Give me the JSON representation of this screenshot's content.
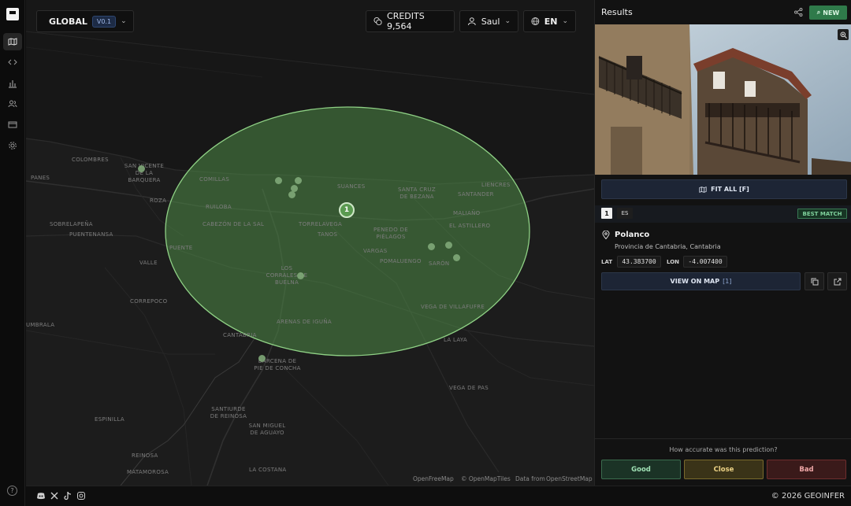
{
  "map_bar": {
    "scope_label": "GLOBAL",
    "version": "V0.1",
    "credits_label": "CREDITS 9,564",
    "user_name": "Saul",
    "language": "EN"
  },
  "map": {
    "result_pin_label": "1",
    "area_color": "#4f8a47",
    "place_labels": [
      "COLOMBRES",
      "SAN VICENTE DE LA BARQUERA",
      "PANES",
      "COMILLAS",
      "SUANCES",
      "SANTA CRUZ DE BEZANA",
      "SANTANDER",
      "LIENCRES",
      "RUILOBA",
      "ROZA",
      "SOBRELAPEÑA",
      "PUENTENANSA",
      "CABEZÓN DE LA SAL",
      "TORRELAVEGA",
      "TANOS",
      "PENEDO DE PIÉLAGOS",
      "MALIAÑO",
      "EL ASTILLERO",
      "PUENTE",
      "VALLE",
      "LOS CORRALES DE BUELNA",
      "VARGAS",
      "POMALUENGO",
      "SARÓN",
      "CORREPOCO",
      "VEGA DE VILLAFUFRE",
      "UMBRALA",
      "ARENAS DE IGUÑA",
      "CANTABRIA",
      "LA LAYA",
      "BÁRCENA DE PIE DE CONCHA",
      "VEGA DE PAS",
      "ESPINILLA",
      "SANTIURDE DE REINOSA",
      "SAN MIGUEL DE AGUAYO",
      "REINOSA",
      "MATAMOROSA",
      "LA COSTANA"
    ],
    "attribution": {
      "openfreemap": "OpenFreeMap",
      "openmaptiles": "© OpenMapTiles",
      "data_from": "Data from",
      "osm": "OpenStreetMap"
    }
  },
  "footer": {
    "copyright": "© 2026 GEOINFER"
  },
  "panel": {
    "title": "Results",
    "new_label": "NEW",
    "fit_all_label": "FIT ALL [F]",
    "result": {
      "rank": "1",
      "country_code": "ES",
      "best_match_label": "BEST MATCH",
      "place_name": "Polanco",
      "region": "Provincia de Cantabria, Cantabria",
      "lat_label": "LAT",
      "lat_value": "43.383700",
      "lon_label": "LON",
      "lon_value": "-4.007400",
      "view_on_map_label": "VIEW ON MAP",
      "view_on_map_count": "[1]"
    },
    "feedback": {
      "question": "How accurate was this prediction?",
      "good_label": "Good",
      "close_label": "Close",
      "bad_label": "Bad"
    }
  }
}
